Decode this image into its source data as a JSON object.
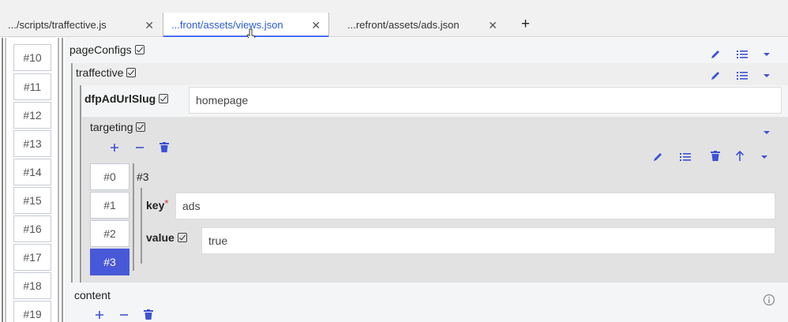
{
  "tabs": [
    {
      "label": ".../scripts/traffective.js",
      "active": false
    },
    {
      "label": "...front/assets/views.json",
      "active": true
    },
    {
      "label": "...refront/assets/ads.json",
      "active": false
    }
  ],
  "new_tab_label": "+",
  "close_glyph": "✕",
  "outer_indices": [
    "#10",
    "#11",
    "#12",
    "#13",
    "#14",
    "#15",
    "#16",
    "#17",
    "#18",
    "#19"
  ],
  "tree": {
    "page_configs_label": "pageConfigs",
    "traffective_label": "traffective",
    "dfp_label": "dfpAdUrlSlug",
    "dfp_value": "homepage",
    "targeting_label": "targeting",
    "item_title": "#3",
    "inner_indices": [
      "#0",
      "#1",
      "#2",
      "#3"
    ],
    "selected_inner_index": "#3",
    "key_label": "key",
    "key_required_mark": "*",
    "key_value": "ads",
    "value_label": "value",
    "value_value": "true",
    "content_label": "content"
  },
  "colors": {
    "accent": "#3d52d5",
    "selected": "#4759d8",
    "required": "#d32f2f",
    "panel_light": "#f3f4f5",
    "panel_mid": "#ebebeb",
    "panel_dark": "#e2e2e2"
  },
  "icons": [
    "pencil-icon",
    "list-icon",
    "caret-down-icon",
    "plus-icon",
    "minus-icon",
    "trash-icon",
    "arrow-up-icon",
    "info-icon",
    "pointer-cursor-icon"
  ]
}
